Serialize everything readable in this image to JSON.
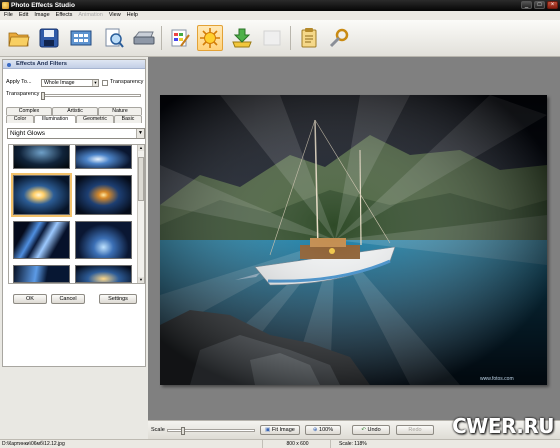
{
  "window": {
    "title": "Photo Effects Studio",
    "min": "_",
    "max": "□",
    "close": "×"
  },
  "menu": [
    {
      "label": "File",
      "enabled": true
    },
    {
      "label": "Edit",
      "enabled": true
    },
    {
      "label": "Image",
      "enabled": true
    },
    {
      "label": "Effects",
      "enabled": true
    },
    {
      "label": "Animation",
      "enabled": false
    },
    {
      "label": "View",
      "enabled": true
    },
    {
      "label": "Help",
      "enabled": true
    }
  ],
  "toolbar": {
    "icons": [
      "open-folder-icon",
      "save-disk-icon",
      "film-strip-icon",
      "magnifier-document-icon",
      "scanner-icon",
      "edit-palette-icon",
      "effects-sun-icon",
      "export-download-icon",
      "blank-icon",
      "notes-clipboard-icon",
      "settings-wrench-icon"
    ],
    "active": "effects-sun-icon"
  },
  "panel": {
    "title": "Effects And Filters",
    "apply_to_label": "Apply To...",
    "apply_to_value": "Whole Image",
    "transparency_check_label": "Transparency",
    "transparency_label": "Transparency",
    "tabs_row1": [
      "Complex",
      "Artistic",
      "Nature"
    ],
    "tabs_row2": [
      "Color",
      "Illumination",
      "Geometric",
      "Basic"
    ],
    "active_tab": "Illumination",
    "effect_select": "Night Glows",
    "ok_label": "OK",
    "cancel_label": "Cancel",
    "settings_label": "Settings"
  },
  "controls": {
    "scale_label": "Scale",
    "fit_image_label": "Fit Image",
    "zoom100_label": "100%",
    "undo_label": "Undo",
    "redo_label": "Redo"
  },
  "status": {
    "path": "D:\\Картинки\\06мб\\12.12.jpg",
    "dimensions": "800 x 600",
    "scale": "Scale: 118%"
  },
  "image_watermark": "www.fotos.com",
  "site_watermark": "CWER.RU",
  "colors": {
    "accent": "#f3c26b",
    "title_bar": "#111111",
    "panel_header": "#c3cfe6",
    "workarea": "#808080"
  }
}
